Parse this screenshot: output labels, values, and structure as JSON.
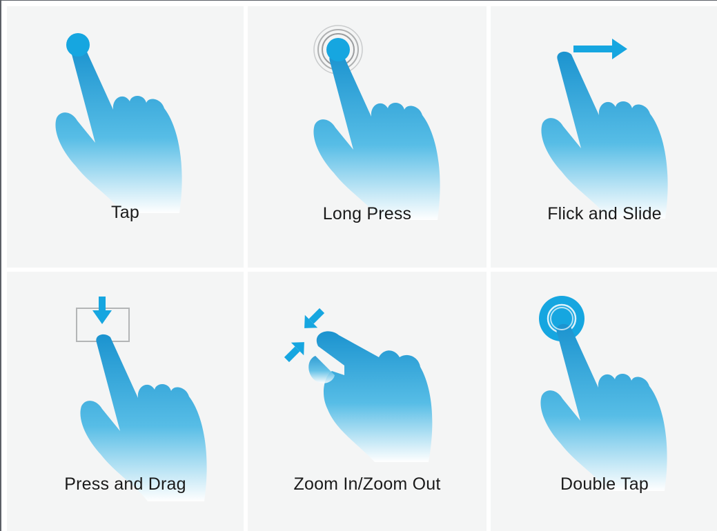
{
  "colors": {
    "accent": "#16a6e0",
    "hand_top": "#1b93cf",
    "hand_bottom": "#ffffff",
    "tile_background": "#f4f5f5",
    "outline_box": "#b3b5b6"
  },
  "gestures": [
    {
      "label": "Tap",
      "icon": "tap-gesture-icon"
    },
    {
      "label": "Long Press",
      "icon": "long-press-gesture-icon"
    },
    {
      "label": "Flick and Slide",
      "icon": "flick-slide-gesture-icon"
    },
    {
      "label": "Press and Drag",
      "icon": "press-drag-gesture-icon"
    },
    {
      "label": "Zoom In/Zoom Out",
      "icon": "zoom-gesture-icon"
    },
    {
      "label": "Double Tap",
      "icon": "double-tap-gesture-icon"
    }
  ]
}
